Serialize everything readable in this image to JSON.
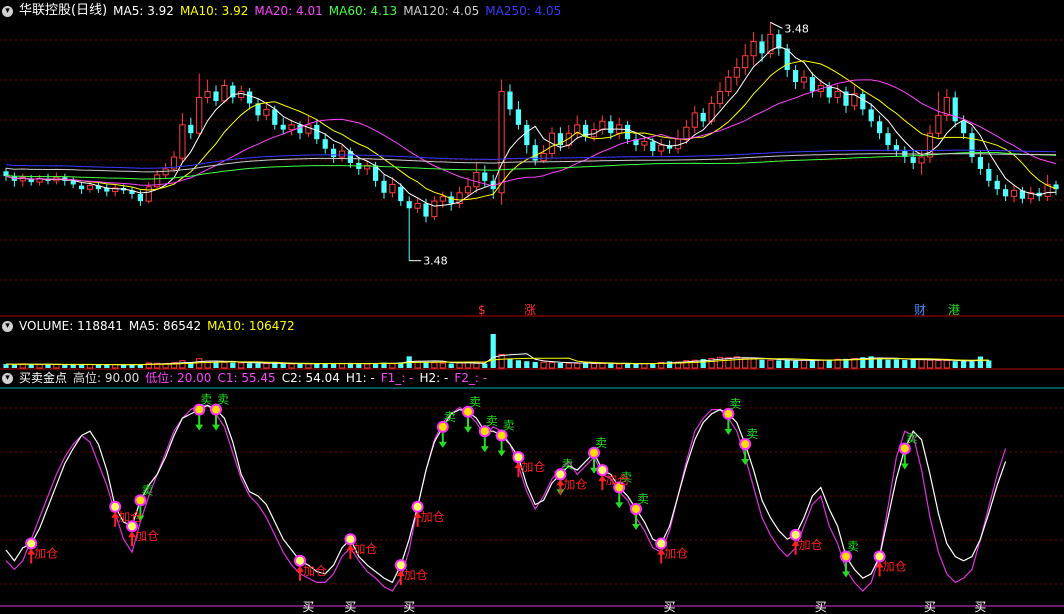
{
  "colors": {
    "up": "#ff3c3c",
    "down": "#54ffff",
    "ma5": "#ffffff",
    "ma10": "#ffff00",
    "ma20": "#ff44ff",
    "ma60": "#44ff44",
    "ma120": "#cccccc",
    "ma250": "#3a3aff",
    "vol_ma5": "#ffffff",
    "vol_ma10": "#ffff00",
    "k": "#ffffff",
    "d": "#dd33dd",
    "buy": "#ff2020",
    "sell": "#22dd22",
    "grid": "#7a0000"
  },
  "main_header": {
    "icon": "collapse-icon",
    "title": "华联控股(日线)",
    "items": [
      {
        "label": "MA5: 3.92",
        "color": "#ffffff"
      },
      {
        "label": "MA10: 3.92",
        "color": "#ffff00"
      },
      {
        "label": "MA20: 4.01",
        "color": "#ff44ff"
      },
      {
        "label": "MA60: 4.13",
        "color": "#44ff44"
      },
      {
        "label": "MA120: 4.05",
        "color": "#cccccc"
      },
      {
        "label": "MA250: 4.05",
        "color": "#3a3aff"
      }
    ]
  },
  "volume_header": {
    "icon": "collapse-icon",
    "items": [
      {
        "label": "VOLUME: 118841",
        "color": "#ffffff"
      },
      {
        "label": "MA5: 86542",
        "color": "#ffffff"
      },
      {
        "label": "MA10: 106472",
        "color": "#ffff00"
      }
    ]
  },
  "indicator_header": {
    "icon": "collapse-icon",
    "items": [
      {
        "label": "买卖金点",
        "color": "#ffffff"
      },
      {
        "label": "高位: 90.00",
        "color": "#dddddd"
      },
      {
        "label": "低位: 20.00",
        "color": "#ff44ff"
      },
      {
        "label": "C1: 55.45",
        "color": "#ff44ff"
      },
      {
        "label": "C2: 54.04",
        "color": "#ffffff"
      },
      {
        "label": "H1: -",
        "color": "#ffffff"
      },
      {
        "label": "F1_: -",
        "color": "#ff44ff"
      },
      {
        "label": "H2: -",
        "color": "#ffffff"
      },
      {
        "label": "F2_: -",
        "color": "#ff44ff"
      }
    ]
  },
  "price_annotations": {
    "high": "3.48",
    "low": "3.48"
  },
  "event_labels": [
    {
      "text": "$",
      "color": "#ff3030"
    },
    {
      "text": "涨",
      "color": "#ff3030"
    },
    {
      "text": "财",
      "color": "#3a8cff"
    },
    {
      "text": "港",
      "color": "#22dd22"
    }
  ],
  "signal_texts": {
    "buy": "加仓",
    "sell": "卖",
    "bottom": "买"
  },
  "chart_data": {
    "type": "candlestick",
    "title": "华联控股(日线)",
    "ylim": [
      3.15,
      5.5
    ],
    "candles": [
      {
        "o": 4.23,
        "c": 4.19,
        "h": 4.26,
        "l": 4.15
      },
      {
        "o": 4.19,
        "c": 4.15,
        "h": 4.22,
        "l": 4.1
      },
      {
        "o": 4.15,
        "c": 4.18,
        "h": 4.21,
        "l": 4.1
      },
      {
        "o": 4.17,
        "c": 4.14,
        "h": 4.2,
        "l": 4.11
      },
      {
        "o": 4.14,
        "c": 4.17,
        "h": 4.2,
        "l": 4.11
      },
      {
        "o": 4.17,
        "c": 4.15,
        "h": 4.21,
        "l": 4.12
      },
      {
        "o": 4.15,
        "c": 4.18,
        "h": 4.22,
        "l": 4.12
      },
      {
        "o": 4.18,
        "c": 4.15,
        "h": 4.21,
        "l": 4.11
      },
      {
        "o": 4.15,
        "c": 4.12,
        "h": 4.18,
        "l": 4.09
      },
      {
        "o": 4.11,
        "c": 4.08,
        "h": 4.14,
        "l": 4.04
      },
      {
        "o": 4.08,
        "c": 4.11,
        "h": 4.14,
        "l": 4.05
      },
      {
        "o": 4.11,
        "c": 4.08,
        "h": 4.14,
        "l": 4.05
      },
      {
        "o": 4.09,
        "c": 4.06,
        "h": 4.12,
        "l": 4.02
      },
      {
        "o": 4.06,
        "c": 4.09,
        "h": 4.12,
        "l": 4.02
      },
      {
        "o": 4.09,
        "c": 4.07,
        "h": 4.12,
        "l": 4.04
      },
      {
        "o": 4.07,
        "c": 4.04,
        "h": 4.1,
        "l": 4.0
      },
      {
        "o": 4.04,
        "c": 3.98,
        "h": 4.07,
        "l": 3.94
      },
      {
        "o": 3.98,
        "c": 4.1,
        "h": 4.14,
        "l": 3.96
      },
      {
        "o": 4.1,
        "c": 4.2,
        "h": 4.24,
        "l": 4.08
      },
      {
        "o": 4.2,
        "c": 4.25,
        "h": 4.3,
        "l": 4.17
      },
      {
        "o": 4.25,
        "c": 4.35,
        "h": 4.4,
        "l": 4.22
      },
      {
        "o": 4.34,
        "c": 4.62,
        "h": 4.72,
        "l": 4.3
      },
      {
        "o": 4.62,
        "c": 4.55,
        "h": 4.68,
        "l": 4.5
      },
      {
        "o": 4.55,
        "c": 4.85,
        "h": 5.05,
        "l": 4.52
      },
      {
        "o": 4.85,
        "c": 4.9,
        "h": 5.0,
        "l": 4.8
      },
      {
        "o": 4.9,
        "c": 4.82,
        "h": 4.95,
        "l": 4.78
      },
      {
        "o": 4.82,
        "c": 4.95,
        "h": 5.0,
        "l": 4.8
      },
      {
        "o": 4.95,
        "c": 4.85,
        "h": 4.98,
        "l": 4.8
      },
      {
        "o": 4.85,
        "c": 4.9,
        "h": 4.95,
        "l": 4.82
      },
      {
        "o": 4.9,
        "c": 4.8,
        "h": 4.93,
        "l": 4.75
      },
      {
        "o": 4.8,
        "c": 4.7,
        "h": 4.84,
        "l": 4.65
      },
      {
        "o": 4.7,
        "c": 4.75,
        "h": 4.8,
        "l": 4.66
      },
      {
        "o": 4.75,
        "c": 4.62,
        "h": 4.78,
        "l": 4.58
      },
      {
        "o": 4.62,
        "c": 4.58,
        "h": 4.68,
        "l": 4.54
      },
      {
        "o": 4.58,
        "c": 4.62,
        "h": 4.66,
        "l": 4.53
      },
      {
        "o": 4.62,
        "c": 4.55,
        "h": 4.65,
        "l": 4.5
      },
      {
        "o": 4.55,
        "c": 4.62,
        "h": 4.7,
        "l": 4.52
      },
      {
        "o": 4.62,
        "c": 4.5,
        "h": 4.66,
        "l": 4.46
      },
      {
        "o": 4.5,
        "c": 4.42,
        "h": 4.55,
        "l": 4.38
      },
      {
        "o": 4.42,
        "c": 4.35,
        "h": 4.46,
        "l": 4.3
      },
      {
        "o": 4.35,
        "c": 4.4,
        "h": 4.45,
        "l": 4.31
      },
      {
        "o": 4.4,
        "c": 4.3,
        "h": 4.43,
        "l": 4.26
      },
      {
        "o": 4.3,
        "c": 4.25,
        "h": 4.34,
        "l": 4.2
      },
      {
        "o": 4.25,
        "c": 4.28,
        "h": 4.32,
        "l": 4.2
      },
      {
        "o": 4.28,
        "c": 4.15,
        "h": 4.31,
        "l": 4.1
      },
      {
        "o": 4.15,
        "c": 4.05,
        "h": 4.2,
        "l": 4.0
      },
      {
        "o": 4.05,
        "c": 4.12,
        "h": 4.18,
        "l": 4.01
      },
      {
        "o": 4.1,
        "c": 3.98,
        "h": 4.13,
        "l": 3.94
      },
      {
        "o": 3.98,
        "c": 3.92,
        "h": 4.02,
        "l": 3.48
      },
      {
        "o": 3.92,
        "c": 3.96,
        "h": 4.0,
        "l": 3.88
      },
      {
        "o": 3.96,
        "c": 3.85,
        "h": 4.0,
        "l": 3.8
      },
      {
        "o": 3.85,
        "c": 3.98,
        "h": 4.02,
        "l": 3.82
      },
      {
        "o": 3.98,
        "c": 4.02,
        "h": 4.06,
        "l": 3.92
      },
      {
        "o": 4.02,
        "c": 3.96,
        "h": 4.06,
        "l": 3.9
      },
      {
        "o": 3.96,
        "c": 4.05,
        "h": 4.1,
        "l": 3.92
      },
      {
        "o": 4.05,
        "c": 4.1,
        "h": 4.18,
        "l": 4.0
      },
      {
        "o": 4.1,
        "c": 4.22,
        "h": 4.3,
        "l": 4.05
      },
      {
        "o": 4.22,
        "c": 4.15,
        "h": 4.28,
        "l": 4.1
      },
      {
        "o": 4.15,
        "c": 4.08,
        "h": 4.2,
        "l": 4.0
      },
      {
        "o": 4.05,
        "c": 4.9,
        "h": 5.0,
        "l": 3.95
      },
      {
        "o": 4.9,
        "c": 4.75,
        "h": 4.96,
        "l": 4.7
      },
      {
        "o": 4.75,
        "c": 4.62,
        "h": 4.82,
        "l": 4.58
      },
      {
        "o": 4.62,
        "c": 4.45,
        "h": 4.66,
        "l": 4.38
      },
      {
        "o": 4.45,
        "c": 4.32,
        "h": 4.5,
        "l": 4.28
      },
      {
        "o": 4.32,
        "c": 4.38,
        "h": 4.45,
        "l": 4.3
      },
      {
        "o": 4.38,
        "c": 4.55,
        "h": 4.6,
        "l": 4.34
      },
      {
        "o": 4.55,
        "c": 4.45,
        "h": 4.6,
        "l": 4.4
      },
      {
        "o": 4.45,
        "c": 4.55,
        "h": 4.62,
        "l": 4.42
      },
      {
        "o": 4.55,
        "c": 4.62,
        "h": 4.7,
        "l": 4.5
      },
      {
        "o": 4.62,
        "c": 4.52,
        "h": 4.66,
        "l": 4.48
      },
      {
        "o": 4.52,
        "c": 4.58,
        "h": 4.64,
        "l": 4.48
      },
      {
        "o": 4.58,
        "c": 4.65,
        "h": 4.7,
        "l": 4.54
      },
      {
        "o": 4.65,
        "c": 4.55,
        "h": 4.7,
        "l": 4.5
      },
      {
        "o": 4.55,
        "c": 4.62,
        "h": 4.68,
        "l": 4.5
      },
      {
        "o": 4.62,
        "c": 4.5,
        "h": 4.65,
        "l": 4.46
      },
      {
        "o": 4.5,
        "c": 4.45,
        "h": 4.55,
        "l": 4.4
      },
      {
        "o": 4.45,
        "c": 4.48,
        "h": 4.52,
        "l": 4.4
      },
      {
        "o": 4.48,
        "c": 4.4,
        "h": 4.51,
        "l": 4.36
      },
      {
        "o": 4.4,
        "c": 4.45,
        "h": 4.5,
        "l": 4.36
      },
      {
        "o": 4.45,
        "c": 4.42,
        "h": 4.49,
        "l": 4.38
      },
      {
        "o": 4.42,
        "c": 4.5,
        "h": 4.58,
        "l": 4.38
      },
      {
        "o": 4.5,
        "c": 4.6,
        "h": 4.66,
        "l": 4.46
      },
      {
        "o": 4.6,
        "c": 4.72,
        "h": 4.78,
        "l": 4.55
      },
      {
        "o": 4.72,
        "c": 4.65,
        "h": 4.76,
        "l": 4.6
      },
      {
        "o": 4.65,
        "c": 4.8,
        "h": 4.86,
        "l": 4.62
      },
      {
        "o": 4.8,
        "c": 4.9,
        "h": 4.98,
        "l": 4.76
      },
      {
        "o": 4.9,
        "c": 5.02,
        "h": 5.08,
        "l": 4.86
      },
      {
        "o": 5.02,
        "c": 5.1,
        "h": 5.18,
        "l": 4.95
      },
      {
        "o": 5.1,
        "c": 5.2,
        "h": 5.3,
        "l": 5.04
      },
      {
        "o": 5.2,
        "c": 5.32,
        "h": 5.4,
        "l": 5.12
      },
      {
        "o": 5.32,
        "c": 5.22,
        "h": 5.38,
        "l": 5.15
      },
      {
        "o": 5.22,
        "c": 5.38,
        "h": 5.48,
        "l": 5.18
      },
      {
        "o": 5.38,
        "c": 5.26,
        "h": 5.42,
        "l": 5.2
      },
      {
        "o": 5.26,
        "c": 5.08,
        "h": 5.3,
        "l": 5.02
      },
      {
        "o": 5.08,
        "c": 4.98,
        "h": 5.12,
        "l": 4.92
      },
      {
        "o": 4.98,
        "c": 5.02,
        "h": 5.08,
        "l": 4.92
      },
      {
        "o": 5.02,
        "c": 4.9,
        "h": 5.06,
        "l": 4.85
      },
      {
        "o": 4.9,
        "c": 4.95,
        "h": 5.0,
        "l": 4.85
      },
      {
        "o": 4.95,
        "c": 4.85,
        "h": 4.98,
        "l": 4.8
      },
      {
        "o": 4.85,
        "c": 4.9,
        "h": 4.96,
        "l": 4.8
      },
      {
        "o": 4.9,
        "c": 4.78,
        "h": 4.94,
        "l": 4.72
      },
      {
        "o": 4.78,
        "c": 4.88,
        "h": 4.95,
        "l": 4.74
      },
      {
        "o": 4.88,
        "c": 4.75,
        "h": 4.92,
        "l": 4.7
      },
      {
        "o": 4.75,
        "c": 4.65,
        "h": 4.8,
        "l": 4.6
      },
      {
        "o": 4.65,
        "c": 4.55,
        "h": 4.7,
        "l": 4.5
      },
      {
        "o": 4.55,
        "c": 4.45,
        "h": 4.6,
        "l": 4.4
      },
      {
        "o": 4.45,
        "c": 4.4,
        "h": 4.5,
        "l": 4.35
      },
      {
        "o": 4.4,
        "c": 4.35,
        "h": 4.44,
        "l": 4.3
      },
      {
        "o": 4.35,
        "c": 4.3,
        "h": 4.4,
        "l": 4.25
      },
      {
        "o": 4.3,
        "c": 4.35,
        "h": 4.4,
        "l": 4.2
      },
      {
        "o": 4.35,
        "c": 4.55,
        "h": 4.62,
        "l": 4.3
      },
      {
        "o": 4.55,
        "c": 4.7,
        "h": 4.9,
        "l": 4.5
      },
      {
        "o": 4.7,
        "c": 4.85,
        "h": 4.92,
        "l": 4.65
      },
      {
        "o": 4.85,
        "c": 4.65,
        "h": 4.9,
        "l": 4.6
      },
      {
        "o": 4.65,
        "c": 4.55,
        "h": 4.7,
        "l": 4.5
      },
      {
        "o": 4.55,
        "c": 4.35,
        "h": 4.6,
        "l": 4.3
      },
      {
        "o": 4.35,
        "c": 4.25,
        "h": 4.4,
        "l": 4.2
      },
      {
        "o": 4.25,
        "c": 4.15,
        "h": 4.3,
        "l": 4.1
      },
      {
        "o": 4.15,
        "c": 4.08,
        "h": 4.2,
        "l": 4.03
      },
      {
        "o": 4.08,
        "c": 4.02,
        "h": 4.12,
        "l": 3.98
      },
      {
        "o": 4.02,
        "c": 4.07,
        "h": 4.12,
        "l": 3.97
      },
      {
        "o": 4.07,
        "c": 4.0,
        "h": 4.1,
        "l": 3.96
      },
      {
        "o": 4.0,
        "c": 4.05,
        "h": 4.1,
        "l": 3.96
      },
      {
        "o": 4.05,
        "c": 4.02,
        "h": 4.09,
        "l": 3.98
      },
      {
        "o": 4.02,
        "c": 4.12,
        "h": 4.2,
        "l": 3.98
      },
      {
        "o": 4.12,
        "c": 4.08,
        "h": 4.15,
        "l": 4.03
      }
    ],
    "volume": [
      40,
      38,
      42,
      36,
      35,
      37,
      36,
      34,
      33,
      40,
      35,
      34,
      33,
      35,
      34,
      33,
      38,
      52,
      48,
      45,
      55,
      75,
      60,
      95,
      70,
      62,
      58,
      55,
      52,
      50,
      48,
      46,
      48,
      44,
      42,
      45,
      43,
      46,
      48,
      50,
      44,
      47,
      45,
      42,
      52,
      55,
      45,
      58,
      120,
      70,
      60,
      55,
      50,
      46,
      52,
      58,
      48,
      45,
      350,
      140,
      95,
      80,
      70,
      62,
      60,
      55,
      52,
      50,
      48,
      50,
      46,
      48,
      44,
      42,
      45,
      43,
      46,
      50,
      58,
      68,
      62,
      75,
      80,
      92,
      98,
      110,
      105,
      115,
      100,
      92,
      85,
      80,
      78,
      82,
      75,
      80,
      78,
      82,
      86,
      90,
      94,
      98,
      110,
      120,
      95,
      85,
      88,
      82,
      92,
      86,
      80,
      76,
      78,
      70,
      72,
      66,
      118,
      78
    ],
    "indicator": {
      "ylim": [
        0,
        100
      ],
      "high_level": 90.0,
      "low_level": 20.0,
      "k": [
        25,
        20,
        26,
        28,
        35,
        45,
        55,
        65,
        72,
        78,
        80,
        74,
        62,
        45,
        38,
        36,
        48,
        55,
        60,
        68,
        78,
        86,
        88,
        90,
        92,
        90,
        86,
        75,
        60,
        52,
        50,
        46,
        38,
        30,
        25,
        20,
        18,
        15,
        14,
        18,
        26,
        30,
        22,
        18,
        15,
        12,
        10,
        18,
        30,
        45,
        62,
        75,
        82,
        88,
        90,
        89,
        86,
        80,
        80,
        78,
        74,
        68,
        55,
        46,
        48,
        56,
        60,
        64,
        62,
        66,
        70,
        62,
        60,
        54,
        50,
        44,
        38,
        30,
        28,
        36,
        50,
        64,
        76,
        84,
        88,
        90,
        88,
        84,
        74,
        62,
        48,
        40,
        34,
        30,
        32,
        40,
        50,
        54,
        44,
        36,
        22,
        16,
        12,
        14,
        22,
        40,
        58,
        72,
        80,
        76,
        60,
        42,
        28,
        22,
        20,
        22,
        30,
        42,
        55,
        66
      ],
      "d": [
        20,
        16,
        20,
        30,
        40,
        50,
        60,
        68,
        74,
        78,
        75,
        65,
        55,
        42,
        30,
        24,
        38,
        50,
        60,
        70,
        80,
        86,
        90,
        92,
        92,
        88,
        82,
        70,
        58,
        50,
        46,
        40,
        32,
        24,
        18,
        14,
        12,
        10,
        10,
        14,
        22,
        26,
        20,
        15,
        12,
        8,
        6,
        12,
        25,
        45,
        62,
        76,
        84,
        88,
        91,
        88,
        84,
        78,
        82,
        80,
        74,
        64,
        52,
        44,
        50,
        58,
        62,
        66,
        60,
        64,
        68,
        60,
        58,
        52,
        48,
        40,
        34,
        26,
        24,
        34,
        50,
        66,
        80,
        86,
        90,
        90,
        86,
        80,
        68,
        54,
        40,
        32,
        26,
        22,
        26,
        36,
        46,
        50,
        36,
        28,
        16,
        10,
        6,
        10,
        22,
        45,
        68,
        80,
        78,
        62,
        40,
        24,
        14,
        10,
        12,
        16,
        30,
        45,
        60,
        72
      ],
      "sell_points": [
        16,
        23,
        25,
        52,
        55,
        57,
        59,
        66,
        70,
        73,
        75,
        86,
        88,
        100,
        107
      ],
      "buy_points": [
        3,
        13,
        15,
        35,
        41,
        47,
        49,
        61,
        66,
        71,
        78,
        94,
        104
      ],
      "bottom_points": [
        36,
        41,
        48,
        79,
        97,
        110,
        116
      ]
    }
  }
}
